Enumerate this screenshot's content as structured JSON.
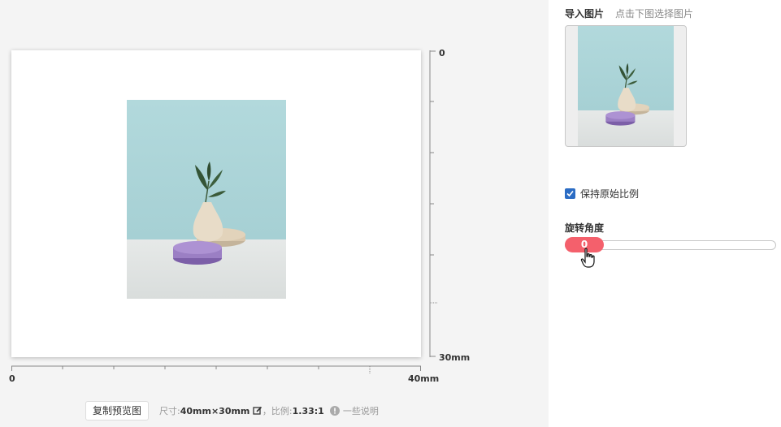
{
  "preview": {
    "copy_button": "复制预览图",
    "size_label": "尺寸:",
    "size_value": "40mm×30mm",
    "ratio_label": "，比例:",
    "ratio_value": "1.33:1",
    "info_label": "一些说明"
  },
  "rulers": {
    "vertical_start": "0",
    "vertical_end": "30mm",
    "horizontal_start": "0",
    "horizontal_end": "40mm"
  },
  "panel": {
    "import_title": "导入图片",
    "import_hint": "点击下图选择图片",
    "keep_ratio_label": "保持原始比例",
    "keep_ratio_checked": true,
    "rotate_title": "旋转角度",
    "rotate_value": "0"
  },
  "colors": {
    "accent": "#f4606c",
    "checkbox": "#2b6cc4",
    "wall": "#a6d0d4",
    "vase_base": "#9b7fc4"
  },
  "icons": [
    "edit-icon",
    "info-icon",
    "check-icon",
    "hand-cursor-icon"
  ]
}
